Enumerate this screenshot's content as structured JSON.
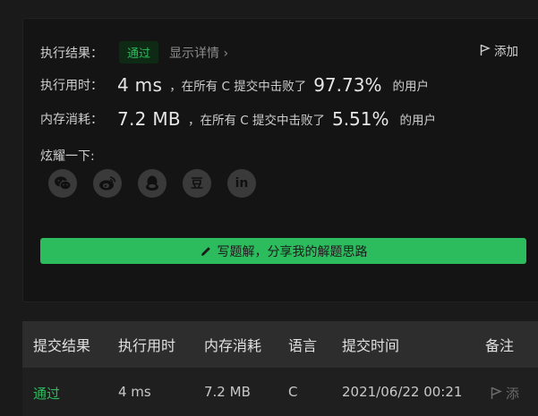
{
  "result": {
    "label": "执行结果：",
    "status": "通过",
    "detail_link": "显示详情",
    "detail_chevron": "›",
    "add_note": "添加"
  },
  "runtime": {
    "label": "执行用时：",
    "value": "4 ms",
    "mid_text": "，在所有 C 提交中击败了",
    "percent": "97.73%",
    "suffix": "的用户"
  },
  "memory": {
    "label": "内存消耗：",
    "value": "7.2 MB",
    "mid_text": "，在所有 C 提交中击败了",
    "percent": "5.51%",
    "suffix": "的用户"
  },
  "share": {
    "label": "炫耀一下:",
    "icons": [
      "wechat-icon",
      "weibo-icon",
      "qq-icon",
      "douban-icon",
      "linkedin-icon"
    ],
    "douban_glyph": "豆",
    "linkedin_glyph": "in"
  },
  "solution_button": {
    "label": "写题解，分享我的解题思路"
  },
  "table": {
    "headers": [
      "提交结果",
      "执行用时",
      "内存消耗",
      "语言",
      "提交时间",
      "备注"
    ],
    "rows": [
      {
        "result": "通过",
        "runtime": "4 ms",
        "memory": "7.2 MB",
        "language": "C",
        "time": "2021/06/22 00:21",
        "note": "添"
      }
    ]
  },
  "colors": {
    "accent": "#2cbb5d",
    "background": "#1a1a1a",
    "card": "#141414",
    "table_header": "#2d2d2d"
  }
}
